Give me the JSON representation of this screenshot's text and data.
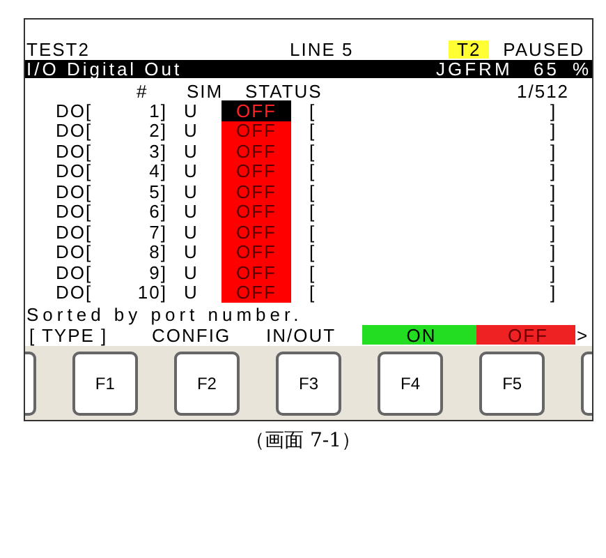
{
  "header": {
    "program": "TEST2",
    "line": "LINE 5",
    "mode": "T2",
    "state": "PAUSED"
  },
  "title_bar": {
    "title": "I/O Digital Out",
    "frame": "JGFRM",
    "override": "65",
    "unit": "%"
  },
  "columns": {
    "number": "#",
    "sim": "SIM",
    "status": "STATUS",
    "page": "1/512"
  },
  "rows": [
    {
      "port": "DO[",
      "number": "1]",
      "sim": "U",
      "status": "OFF",
      "on": false,
      "selected": true,
      "open": "[",
      "close": "]"
    },
    {
      "port": "DO[",
      "number": "2]",
      "sim": "U",
      "status": "OFF",
      "on": false,
      "selected": false,
      "open": "[",
      "close": "]"
    },
    {
      "port": "DO[",
      "number": "3]",
      "sim": "U",
      "status": "OFF",
      "on": false,
      "selected": false,
      "open": "[",
      "close": "]"
    },
    {
      "port": "DO[",
      "number": "4]",
      "sim": "U",
      "status": "OFF",
      "on": false,
      "selected": false,
      "open": "[",
      "close": "]"
    },
    {
      "port": "DO[",
      "number": "5]",
      "sim": "U",
      "status": "OFF",
      "on": false,
      "selected": false,
      "open": "[",
      "close": "]"
    },
    {
      "port": "DO[",
      "number": "6]",
      "sim": "U",
      "status": "OFF",
      "on": false,
      "selected": false,
      "open": "[",
      "close": "]"
    },
    {
      "port": "DO[",
      "number": "7]",
      "sim": "U",
      "status": "OFF",
      "on": false,
      "selected": false,
      "open": "[",
      "close": "]"
    },
    {
      "port": "DO[",
      "number": "8]",
      "sim": "U",
      "status": "OFF",
      "on": false,
      "selected": false,
      "open": "[",
      "close": "]"
    },
    {
      "port": "DO[",
      "number": "9]",
      "sim": "U",
      "status": "OFF",
      "on": false,
      "selected": false,
      "open": "[",
      "close": "]"
    },
    {
      "port": "DO[",
      "number": "10]",
      "sim": "U",
      "status": "OFF",
      "on": false,
      "selected": false,
      "open": "[",
      "close": "]"
    }
  ],
  "message": "Sorted by port number.",
  "function_labels": [
    {
      "label": "[ TYPE ]",
      "kind": "plain"
    },
    {
      "label": "CONFIG",
      "kind": "plain"
    },
    {
      "label": "IN/OUT",
      "kind": "plain"
    },
    {
      "label": "ON",
      "kind": "green"
    },
    {
      "label": "OFF",
      "kind": "red"
    }
  ],
  "more": ">",
  "keys": [
    "F1",
    "F2",
    "F3",
    "F4",
    "F5"
  ],
  "caption": "（画面 7-1）"
}
